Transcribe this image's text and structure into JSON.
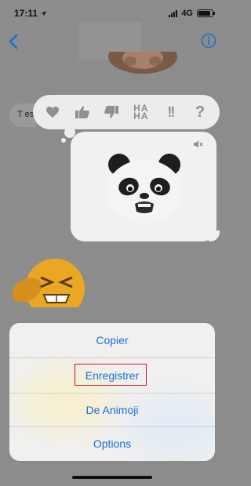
{
  "status_bar": {
    "time": "17:11",
    "network": "4G"
  },
  "conversation": {
    "incoming_preview": "T es"
  },
  "tapback": {
    "reactions": [
      {
        "icon": "heart-icon"
      },
      {
        "icon": "thumbs-up-icon"
      },
      {
        "icon": "thumbs-down-icon"
      },
      {
        "icon": "haha-icon",
        "label_line1": "HA",
        "label_line2": "HA"
      },
      {
        "icon": "exclamation-icon",
        "label": "!!"
      },
      {
        "icon": "question-icon",
        "label": "?"
      }
    ]
  },
  "action_sheet": {
    "items": [
      {
        "label": "Copier"
      },
      {
        "label": "Enregistrer"
      },
      {
        "label": "De Animoji"
      },
      {
        "label": "Options"
      }
    ]
  },
  "colors": {
    "accent": "#1a6fd0",
    "highlight_box": "#c8102e"
  }
}
